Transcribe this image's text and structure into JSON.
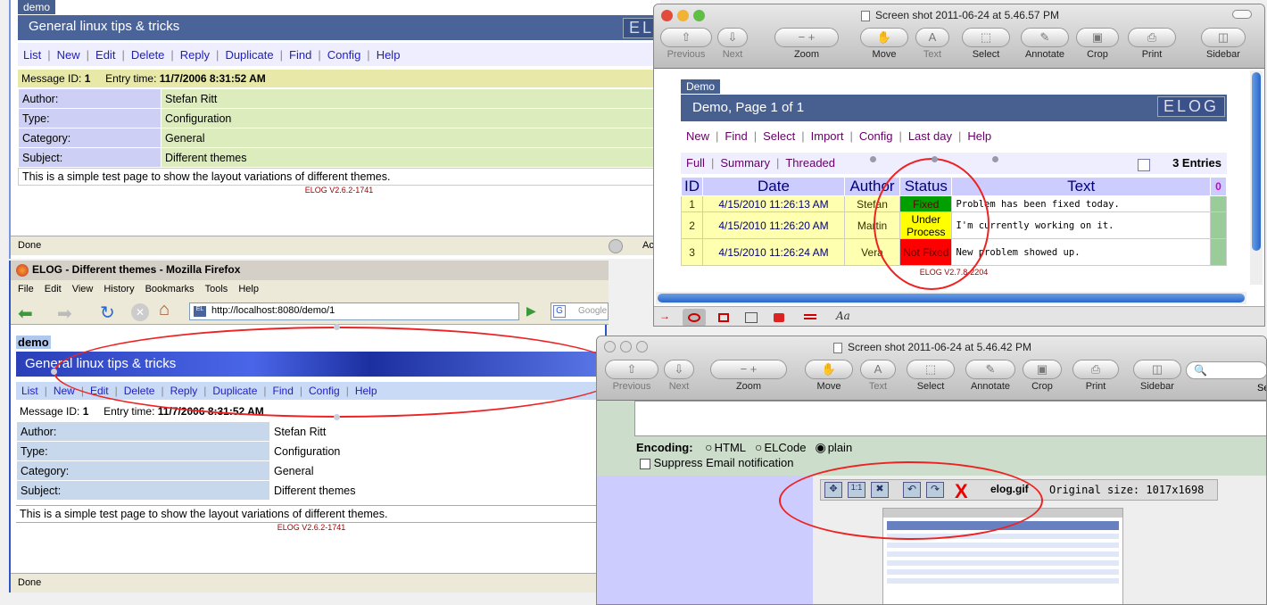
{
  "back": {
    "demo_tab": "demo",
    "title": "General linux tips & tricks",
    "menu": [
      "List",
      "New",
      "Edit",
      "Delete",
      "Reply",
      "Duplicate",
      "Find",
      "Config",
      "Help"
    ],
    "msg_label": "Message ID:",
    "msg_id": "1",
    "entry_label": "Entry time:",
    "entry_time": "11/7/2006 8:31:52 AM",
    "rows": [
      {
        "k": "Author:",
        "v": "Stefan Ritt"
      },
      {
        "k": "Type:",
        "v": "Configuration"
      },
      {
        "k": "Category:",
        "v": "General"
      },
      {
        "k": "Subject:",
        "v": "Different themes"
      }
    ],
    "body": "This is a simple test page to show the layout variations of different themes.",
    "version": "ELOG V2.6.2-1741",
    "status": "Done",
    "logo": "EL",
    "ac": "Ac"
  },
  "firefox": {
    "window_title": "ELOG - Different themes - Mozilla Firefox",
    "menubar": [
      "File",
      "Edit",
      "View",
      "History",
      "Bookmarks",
      "Tools",
      "Help"
    ],
    "url": "http://localhost:8080/demo/1",
    "search_placeholder": "Google",
    "demo_tab": "demo",
    "title": "General linux tips & tricks",
    "menu": [
      "List",
      "New",
      "Edit",
      "Delete",
      "Reply",
      "Duplicate",
      "Find",
      "Config",
      "Help"
    ],
    "msg_label": "Message ID:",
    "msg_id": "1",
    "entry_label": "Entry time:",
    "entry_time": "11/7/2006 8:31:52 AM",
    "rows": [
      {
        "k": "Author:",
        "v": "Stefan Ritt"
      },
      {
        "k": "Type:",
        "v": "Configuration"
      },
      {
        "k": "Category:",
        "v": "General"
      },
      {
        "k": "Subject:",
        "v": "Different themes"
      }
    ],
    "body": "This is a simple test page to show the layout variations of different themes.",
    "version": "ELOG V2.6.2-1741",
    "status": "Done"
  },
  "preview1": {
    "window_title": "Screen shot 2011-06-24 at 5.46.57 PM",
    "toolbar": [
      "Previous",
      "Next",
      "Zoom",
      "Move",
      "Text",
      "Select",
      "Annotate",
      "Crop",
      "Print",
      "Sidebar"
    ],
    "demo_tab": "Demo",
    "title": "Demo, Page 1 of 1",
    "logo": "ELOG",
    "menu": [
      "New",
      "Find",
      "Select",
      "Import",
      "Config",
      "Last day",
      "Help"
    ],
    "views": [
      "Full",
      "Summary",
      "Threaded"
    ],
    "entries": "3 Entries",
    "headers": [
      "ID",
      "Date",
      "Author",
      "Status",
      "Text"
    ],
    "rows": [
      {
        "id": "1",
        "date": "4/15/2010 11:26:13 AM",
        "author": "Stefan",
        "status": "Fixed",
        "status_color": "#00a000",
        "text": "Problem has been fixed today."
      },
      {
        "id": "2",
        "date": "4/15/2010 11:26:20 AM",
        "author": "Martin",
        "status": "Under Process",
        "status_color": "#ffff00",
        "text": "I'm currently working on it."
      },
      {
        "id": "3",
        "date": "4/15/2010 11:26:24 AM",
        "author": "Vera",
        "status": "Not Fixed",
        "status_color": "#ff0000",
        "text": "New problem showed up."
      }
    ],
    "version": "ELOG V2.7.8-2204"
  },
  "preview2": {
    "window_title": "Screen shot 2011-06-24 at 5.46.42 PM",
    "toolbar": [
      "Previous",
      "Next",
      "Zoom",
      "Move",
      "Text",
      "Select",
      "Annotate",
      "Crop",
      "Print",
      "Sidebar"
    ],
    "search_cut": "Sear",
    "encoding_label": "Encoding:",
    "encodings": [
      "HTML",
      "ELCode",
      "plain"
    ],
    "suppress": "Suppress Email notification",
    "file_name": "elog.gif",
    "file_info": "Original size: 1017x1698"
  }
}
